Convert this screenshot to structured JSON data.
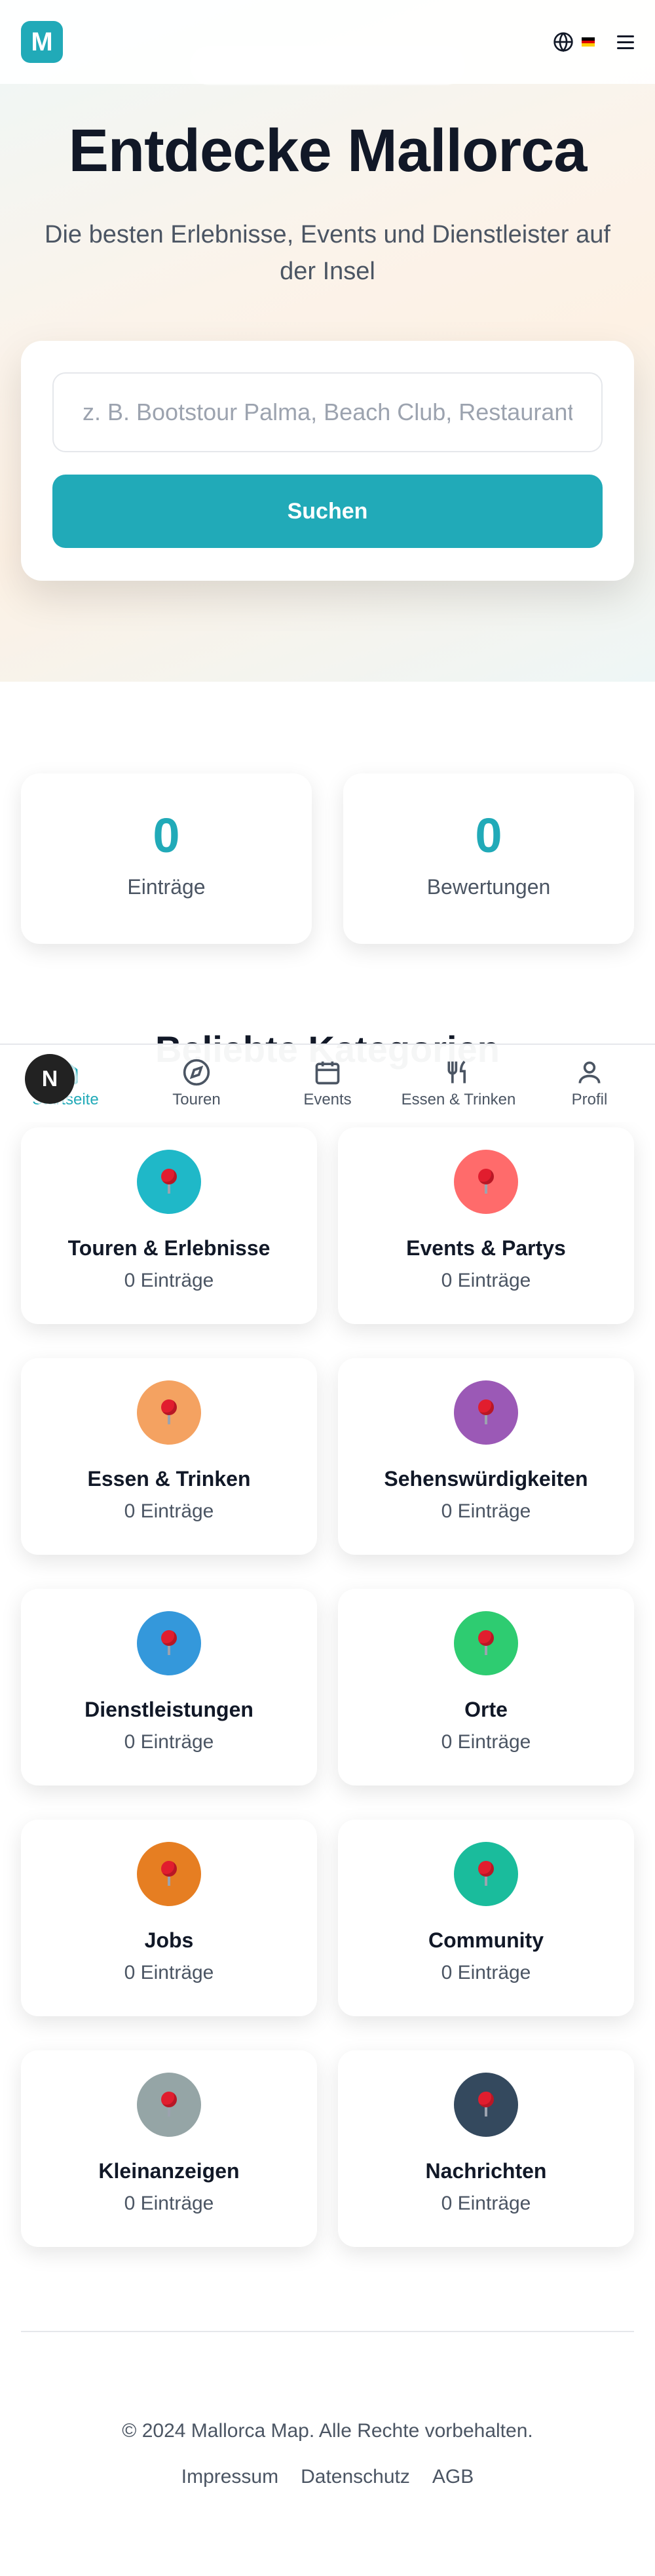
{
  "header": {
    "logo_letter": "M",
    "language_flag": "de",
    "icons": {
      "globe": "globe-icon",
      "menu": "hamburger-menu-icon"
    }
  },
  "hero": {
    "title": "Entdecke Mallorca",
    "subtitle": "Die besten Erlebnisse, Events und Dienstleister auf der Insel",
    "search_placeholder": "z. B. Bootstour Palma, Beach Club, Restaurant",
    "search_value": "",
    "search_button": "Suchen"
  },
  "stats": [
    {
      "value": "0",
      "label": "Einträge"
    },
    {
      "value": "0",
      "label": "Bewertungen"
    }
  ],
  "categories_section": {
    "title": "Beliebte Kategorien",
    "items": [
      {
        "title": "Touren & Erlebnisse",
        "count": "0 Einträge",
        "color": "#1fb8c8"
      },
      {
        "title": "Events & Partys",
        "count": "0 Einträge",
        "color": "#ff6b6b"
      },
      {
        "title": "Essen & Trinken",
        "count": "0 Einträge",
        "color": "#f4a261"
      },
      {
        "title": "Sehenswürdigkeiten",
        "count": "0 Einträge",
        "color": "#9b59b6"
      },
      {
        "title": "Dienstleistungen",
        "count": "0 Einträge",
        "color": "#3498db"
      },
      {
        "title": "Orte",
        "count": "0 Einträge",
        "color": "#2ecc71"
      },
      {
        "title": "Jobs",
        "count": "0 Einträge",
        "color": "#e67e22"
      },
      {
        "title": "Community",
        "count": "0 Einträge",
        "color": "#1abc9c"
      },
      {
        "title": "Kleinanzeigen",
        "count": "0 Einträge",
        "color": "#95a5a6"
      },
      {
        "title": "Nachrichten",
        "count": "0 Einträge",
        "color": "#34495e"
      }
    ]
  },
  "bottom_nav": {
    "items": [
      {
        "label": "Startseite",
        "icon": "home-icon",
        "active": true
      },
      {
        "label": "Touren",
        "icon": "compass-icon",
        "active": false
      },
      {
        "label": "Events",
        "icon": "calendar-icon",
        "active": false
      },
      {
        "label": "Essen & Trinken",
        "icon": "utensils-icon",
        "active": false
      },
      {
        "label": "Profil",
        "icon": "user-icon",
        "active": false
      }
    ],
    "fab_letter": "N"
  },
  "footer": {
    "copyright": "© 2024 Mallorca Map. Alle Rechte vorbehalten.",
    "links": [
      "Impressum",
      "Datenschutz",
      "AGB"
    ]
  },
  "colors": {
    "accent": "#21aab8",
    "text_dark": "#111827",
    "text_muted": "#4b5563"
  }
}
